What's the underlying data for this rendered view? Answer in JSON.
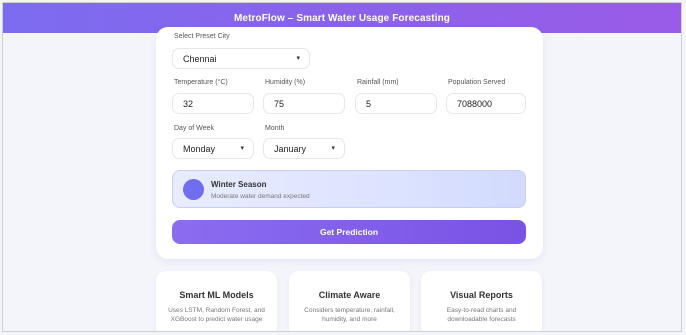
{
  "header": {
    "title": "MetroFlow – Smart Water Usage Forecasting"
  },
  "form": {
    "city": {
      "label": "Select Preset City",
      "value": "Chennai"
    },
    "temperature": {
      "label": "Temperature (°C)",
      "value": "32"
    },
    "humidity": {
      "label": "Humidity (%)",
      "value": "75"
    },
    "rainfall": {
      "label": "Rainfall (mm)",
      "value": "5"
    },
    "population": {
      "label": "Population Served",
      "value": "7088000"
    },
    "day": {
      "label": "Day of Week",
      "value": "Monday"
    },
    "month": {
      "label": "Month",
      "value": "January"
    }
  },
  "season": {
    "title": "Winter Season",
    "description": "Moderate water demand expected",
    "icon_color": "#6f6ef0"
  },
  "predict_button": {
    "label": "Get Prediction"
  },
  "features": [
    {
      "title": "Smart ML Models",
      "desc_line1": "Uses LSTM, Random Forest, and",
      "desc_line2": "XGBoost to predict water usage"
    },
    {
      "title": "Climate Aware",
      "desc_line1": "Considers temperature, rainfall,",
      "desc_line2": "humidity, and more"
    },
    {
      "title": "Visual Reports",
      "desc_line1": "Easy-to-read charts and",
      "desc_line2": "downloadable forecasts"
    }
  ],
  "colors": {
    "accent": "#7a52e6",
    "header_start": "#7c6cf0",
    "header_end": "#9a5be8"
  },
  "icons": {
    "select_chevron": "chevron-down-icon",
    "season": "season-circle-icon"
  }
}
